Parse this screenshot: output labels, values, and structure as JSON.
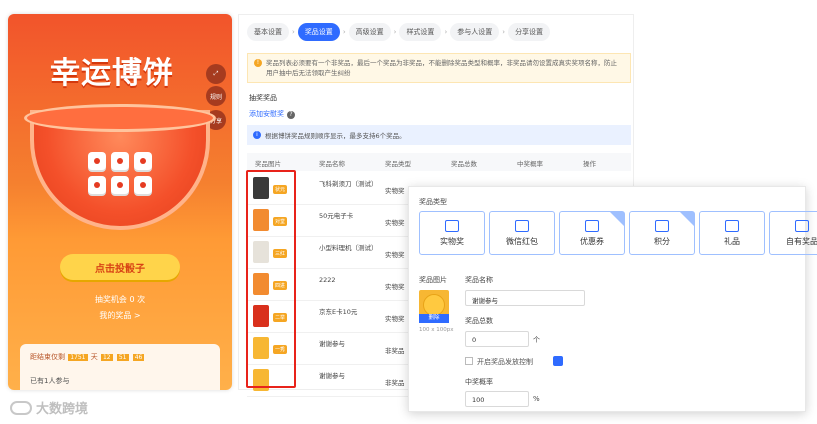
{
  "preview": {
    "title": "幸运博饼",
    "side_buttons": [
      "规则",
      "分享"
    ],
    "shake_button": "点击投骰子",
    "chances": "抽奖机会 0 次",
    "my_prizes": "我的奖品 >",
    "countdown_label": "距结束仅剩",
    "countdown_values": [
      "1751",
      "天",
      "12",
      "51",
      "46"
    ],
    "participants": "已有1人参与"
  },
  "settings": {
    "tabs": [
      {
        "label": "基本设置",
        "active": false
      },
      {
        "label": "奖品设置",
        "active": true
      },
      {
        "label": "高级设置",
        "active": false
      },
      {
        "label": "样式设置",
        "active": false
      },
      {
        "label": "参与人设置",
        "active": false
      },
      {
        "label": "分享设置",
        "active": false
      }
    ],
    "notice": "奖品列表必须要有一个非奖品，最后一个奖品为非奖品，不能删除奖品类型和概率，非奖品请勿设置成真实奖项名称，防止用户抽中后无法领取产生纠纷",
    "section_title": "抽奖奖品",
    "add_link": "添加安慰奖",
    "info": "根据博饼奖品规则顺序显示，最多支持6个奖品。",
    "columns": [
      "奖品图片",
      "奖品名称",
      "奖品类型",
      "奖品总数",
      "中奖概率",
      "操作"
    ],
    "rows": [
      {
        "tag": "状元",
        "name": "飞科剃须刀（测试）",
        "type": "实物奖",
        "color": "#3a3a3a"
      },
      {
        "tag": "对堂",
        "name": "50元电子卡",
        "type": "实物奖",
        "color": "#f28b30"
      },
      {
        "tag": "三红",
        "name": "小型料理机（测试）",
        "type": "实物奖",
        "color": "#e6e2da"
      },
      {
        "tag": "四进",
        "name": "2222",
        "type": "实物奖",
        "color": "#f28b30"
      },
      {
        "tag": "二举",
        "name": "京东E卡10元",
        "type": "实物奖",
        "color": "#d9301c"
      },
      {
        "tag": "一秀",
        "name": "谢谢参与",
        "type": "非奖品",
        "color": "#f7b733"
      },
      {
        "tag": "",
        "name": "谢谢参与",
        "type": "非奖品",
        "color": "#f7b733"
      }
    ]
  },
  "popup": {
    "type_label": "奖品类型",
    "types": [
      {
        "label": "实物奖",
        "corner": ""
      },
      {
        "label": "微信红包",
        "corner": ""
      },
      {
        "label": "优惠券",
        "corner": "blue"
      },
      {
        "label": "积分",
        "corner": "blue"
      },
      {
        "label": "礼品",
        "corner": ""
      },
      {
        "label": "自有奖品",
        "corner": "red"
      }
    ],
    "image_label": "奖品图片",
    "delete_label": "删除",
    "image_size": "100 x 100px",
    "name_label": "奖品名称",
    "name_value": "谢谢参与",
    "total_label": "奖品总数",
    "total_value": "0",
    "total_unit": "个",
    "control_label": "开启奖品发放控制",
    "rate_label": "中奖概率",
    "rate_value": "100",
    "rate_unit": "%"
  },
  "watermark": "大数跨境"
}
